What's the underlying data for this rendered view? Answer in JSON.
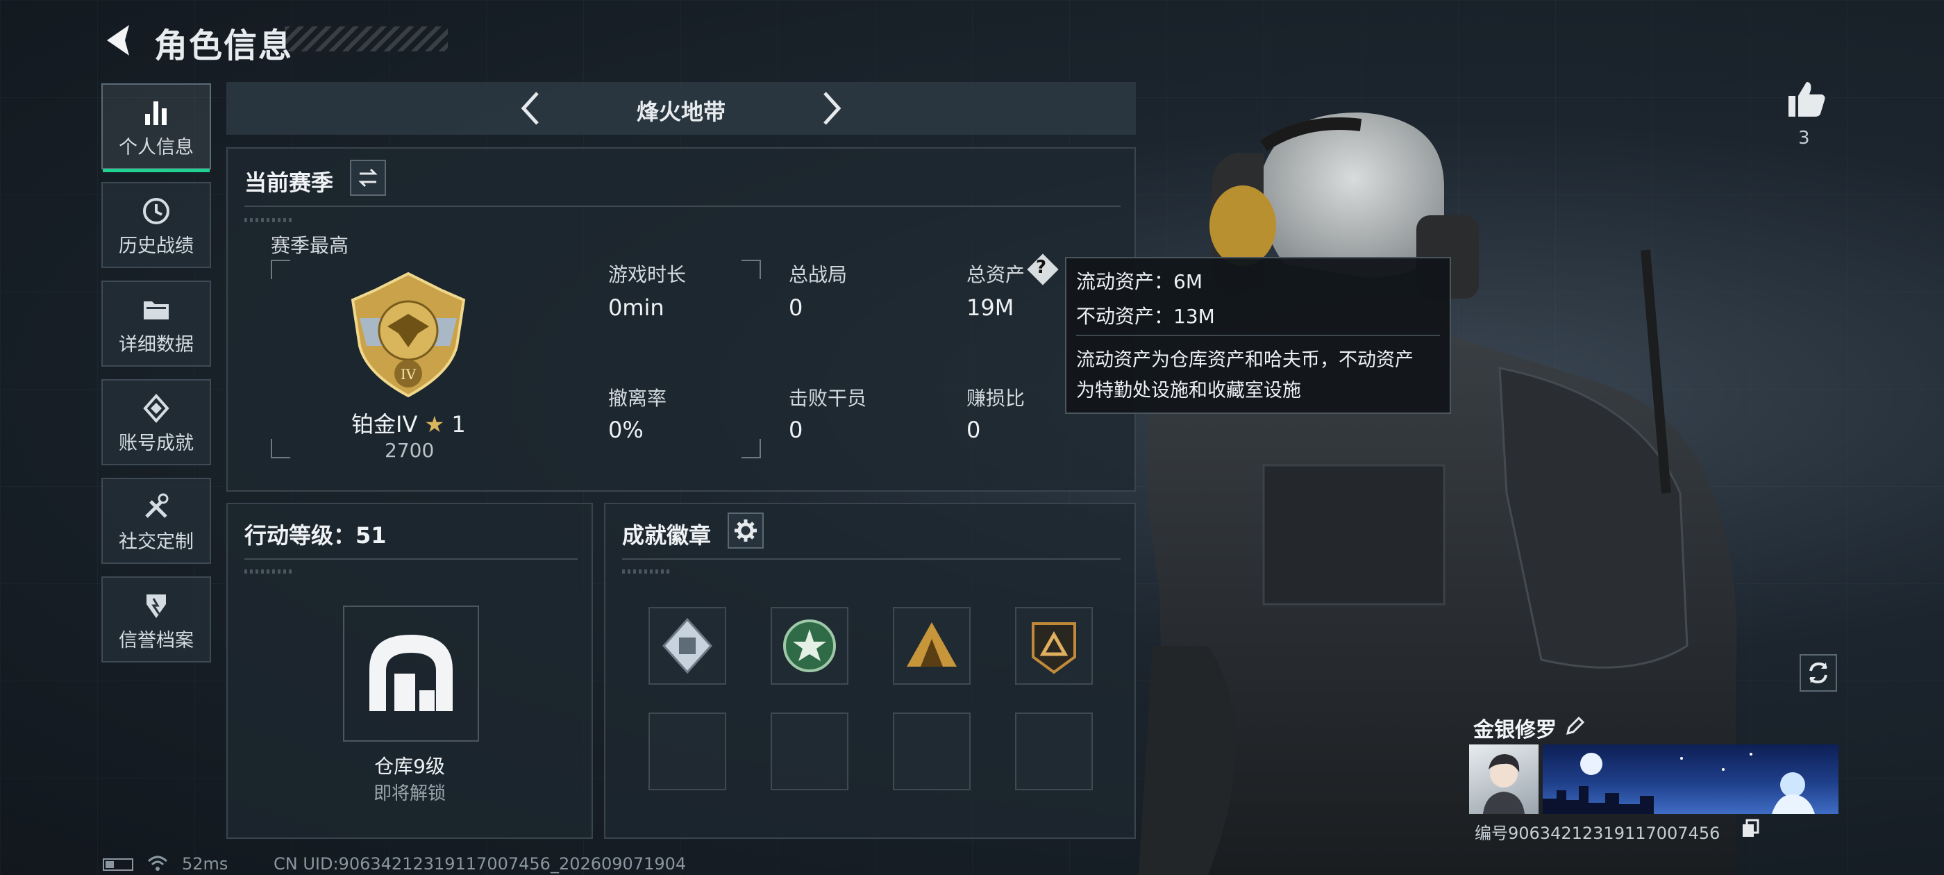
{
  "header": {
    "title": "角色信息"
  },
  "sidebar": {
    "items": [
      {
        "label": "个人信息",
        "icon": "bar-chart-icon",
        "active": true
      },
      {
        "label": "历史战绩",
        "icon": "history-clock-icon",
        "active": false
      },
      {
        "label": "详细数据",
        "icon": "folder-icon",
        "active": false
      },
      {
        "label": "账号成就",
        "icon": "achievement-icon",
        "active": false
      },
      {
        "label": "社交定制",
        "icon": "tools-icon",
        "active": false
      },
      {
        "label": "信誉档案",
        "icon": "shield-icon",
        "active": false
      }
    ]
  },
  "mode": {
    "label": "烽火地带"
  },
  "season": {
    "title": "当前赛季",
    "best_label": "赛季最高",
    "rank": "铂金IV",
    "stars": "1",
    "score": "2700",
    "rank_badge_numeral": "IV",
    "stats": [
      {
        "label": "游戏时长",
        "value": "0min"
      },
      {
        "label": "总战局",
        "value": "0"
      },
      {
        "label": "总资产",
        "value": "19M"
      },
      {
        "label": "撤离率",
        "value": "0%"
      },
      {
        "label": "击败干员",
        "value": "0"
      },
      {
        "label": "赚损比",
        "value": "0"
      }
    ]
  },
  "tooltip": {
    "liquid": "流动资产：6M",
    "fixed": "不动资产：13M",
    "desc_line1": "流动资产为仓库资产和哈夫币，不动资产",
    "desc_line2": "为特勤处设施和收藏室设施"
  },
  "action_level": {
    "title": "行动等级：51",
    "unlock_name": "仓库9级",
    "unlock_status": "即将解锁"
  },
  "badges": {
    "title": "成就徽章",
    "slots_filled": 4,
    "slots_total": 8
  },
  "profile": {
    "likes": "3",
    "name": "金银修罗",
    "id_text": "编号9063421231911700745​6"
  },
  "status_bar": {
    "ping": "52ms",
    "uid": "CN UID:9063421231911700745​6_202609071904"
  },
  "colors": {
    "accent": "#1fd28f",
    "panel": "#1e2830",
    "gold": "#c9a24a"
  }
}
